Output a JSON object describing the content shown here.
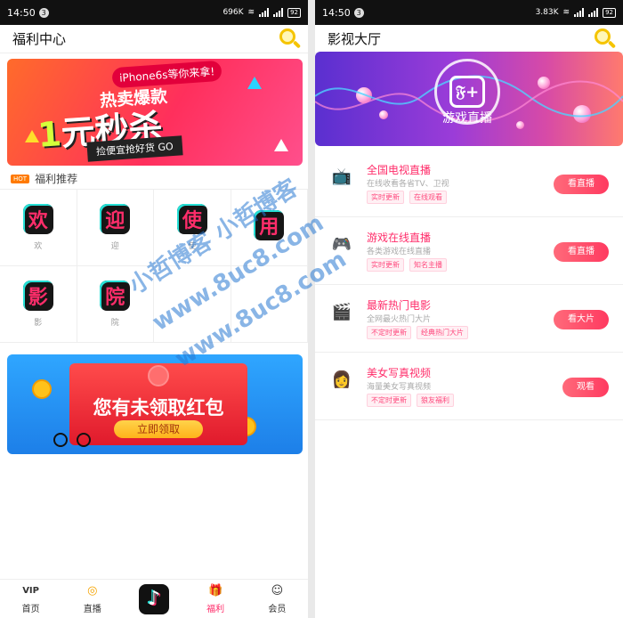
{
  "left": {
    "status": {
      "time": "14:50",
      "dot": "3",
      "speed": "696K",
      "battery": "92"
    },
    "title": "福利中心",
    "banner1": {
      "top": "iPhone6s等你来拿!",
      "mid": "热卖爆款",
      "big_num": "1",
      "big_text": "元秒杀",
      "sub": "捡便宜抢好货 GO"
    },
    "hot": {
      "badge": "HOT",
      "label": "福利推荐"
    },
    "grid": [
      {
        "char": "欢",
        "label": "欢"
      },
      {
        "char": "迎",
        "label": "迎"
      },
      {
        "char": "使",
        "label": "使"
      },
      {
        "char": "用",
        "label": ""
      },
      {
        "char": "影",
        "label": "影"
      },
      {
        "char": "院",
        "label": "院"
      },
      {
        "char": "",
        "label": ""
      },
      {
        "char": "",
        "label": ""
      }
    ],
    "banner2": {
      "title": "您有未领取红包",
      "button": "立即领取"
    },
    "nav": [
      {
        "icon": "VIP",
        "label": "首页"
      },
      {
        "icon": "◎",
        "label": "直播"
      },
      {
        "icon": "♪",
        "label": ""
      },
      {
        "icon": "🎁",
        "label": "福利"
      },
      {
        "icon": "☺",
        "label": "会员"
      }
    ]
  },
  "right": {
    "status": {
      "time": "14:50",
      "dot": "3",
      "speed": "3.83K",
      "battery": "92"
    },
    "title": "影视大厅",
    "banner": {
      "logo": "𝔉+",
      "text": "游戏直播"
    },
    "list": [
      {
        "icon": "📺",
        "title": "全国电视直播",
        "desc": "在线收看各省TV、卫视",
        "tags": [
          "实时更新",
          "在线观看"
        ],
        "button": "看直播"
      },
      {
        "icon": "🎮",
        "title": "游戏在线直播",
        "desc": "各类游戏在线直播",
        "tags": [
          "实时更新",
          "知名主播"
        ],
        "button": "看直播"
      },
      {
        "icon": "🎬",
        "title": "最新热门电影",
        "desc": "全网最火热门大片",
        "tags": [
          "不定时更新",
          "经典热门大片"
        ],
        "button": "看大片"
      },
      {
        "icon": "👩",
        "title": "美女写真视频",
        "desc": "海量美女写真视频",
        "tags": [
          "不定时更新",
          "狼友福利"
        ],
        "button": "观看"
      }
    ]
  },
  "watermark": {
    "line1": "小哲博客 小哲博客",
    "line2": "www.8uc8.com",
    "line3": "www.8uc8.com"
  },
  "colors": {
    "accent": "#ff2d6a",
    "search": "#f5c400",
    "button_gradient_start": "#ff6a7a",
    "button_gradient_end": "#ff3a60"
  }
}
